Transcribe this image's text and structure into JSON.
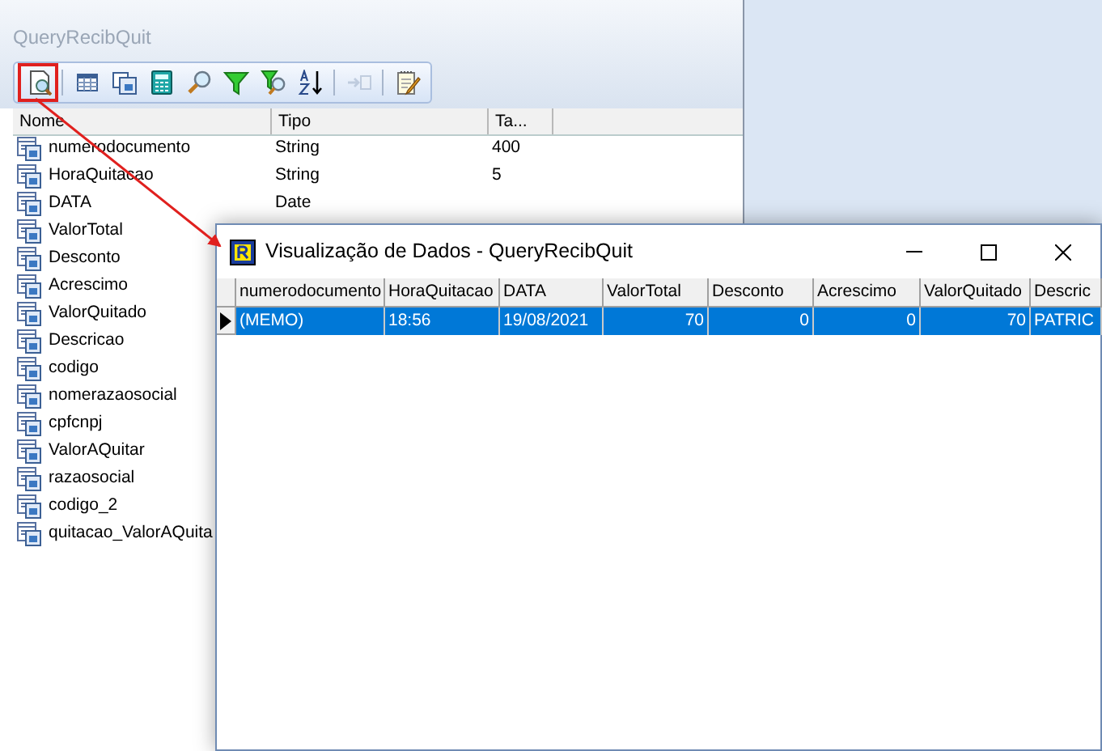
{
  "back_window": {
    "title": "QueryRecibQuit",
    "toolbar": [
      {
        "kind": "preview",
        "disabled": false,
        "highlighted": true
      },
      {
        "kind": "table",
        "disabled": false,
        "highlighted": false
      },
      {
        "kind": "forms",
        "disabled": false,
        "highlighted": false
      },
      {
        "kind": "calculator",
        "disabled": false,
        "highlighted": false
      },
      {
        "kind": "search",
        "disabled": false,
        "highlighted": false
      },
      {
        "kind": "filter",
        "disabled": false,
        "highlighted": false
      },
      {
        "kind": "filter-search",
        "disabled": false,
        "highlighted": false
      },
      {
        "kind": "sort",
        "disabled": false,
        "highlighted": false
      },
      {
        "kind": "insert",
        "disabled": true,
        "highlighted": false
      },
      {
        "kind": "notepad",
        "disabled": false,
        "highlighted": false
      }
    ],
    "columns": [
      "Nome",
      "Tipo",
      "Ta..."
    ],
    "fields": [
      {
        "name": "numerodocumento",
        "type": "String",
        "size": "400"
      },
      {
        "name": "HoraQuitacao",
        "type": "String",
        "size": "5"
      },
      {
        "name": "DATA",
        "type": "Date"
      },
      {
        "name": "ValorTotal"
      },
      {
        "name": "Desconto"
      },
      {
        "name": "Acrescimo"
      },
      {
        "name": "ValorQuitado"
      },
      {
        "name": "Descricao"
      },
      {
        "name": "codigo"
      },
      {
        "name": "nomerazaosocial"
      },
      {
        "name": "cpfcnpj"
      },
      {
        "name": "ValorAQuitar"
      },
      {
        "name": "razaosocial"
      },
      {
        "name": "codigo_2"
      },
      {
        "name": "quitacao_ValorAQuita"
      }
    ]
  },
  "data_window": {
    "title": "Visualização de Dados - QueryRecibQuit",
    "columns": [
      "numerodocumento",
      "HoraQuitacao",
      "DATA",
      "ValorTotal",
      "Desconto",
      "Acrescimo",
      "ValorQuitado",
      "Descric"
    ],
    "rows": [
      {
        "selected": true,
        "cells": [
          "(MEMO)",
          "18:56",
          "19/08/2021",
          "70",
          "0",
          "0",
          "70",
          "PATRIC"
        ]
      }
    ]
  }
}
